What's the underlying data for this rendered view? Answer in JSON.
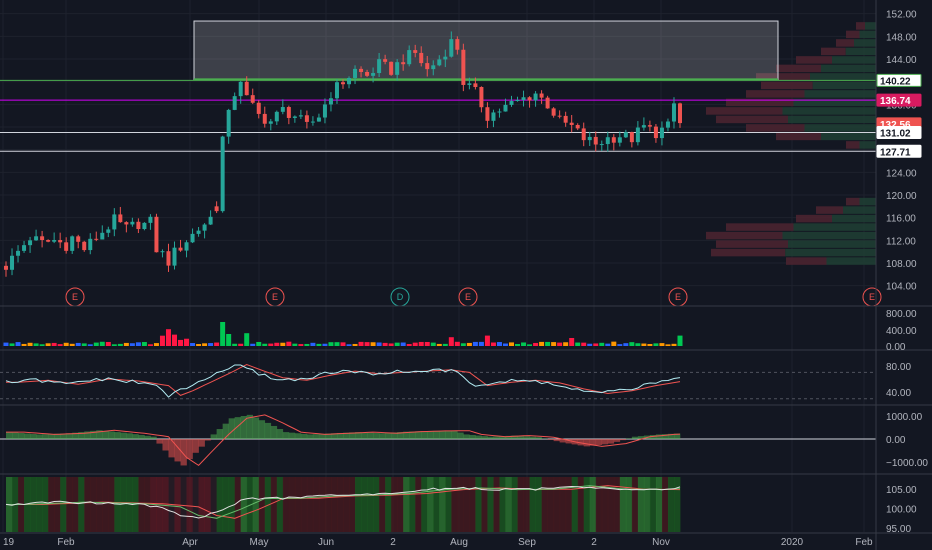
{
  "colors": {
    "background": "#131722",
    "grid": "#1e222d",
    "separator": "#363a45",
    "up": "#26a69a",
    "down": "#ef5350",
    "bright_green": "#4caf50",
    "magenta": "#d500f9",
    "green_line": "#4caf50",
    "white_line": "#d1d4dc",
    "rsi": "#b2ebf2",
    "ma": "#ef5350",
    "vol_red": "#ff1744",
    "vol_orange": "#ff9800",
    "vol_blue": "#2962ff",
    "vol_green": "#00c853"
  },
  "x_axis": {
    "labels": [
      "19",
      "Feb",
      "Apr",
      "May",
      "Jun",
      "2",
      "Aug",
      "Sep",
      "2",
      "Nov",
      "2020",
      "Feb"
    ]
  },
  "price_panel": {
    "y_ticks": [
      "152.00",
      "148.00",
      "144.00",
      "140.00",
      "136.00",
      "132.00",
      "128.00",
      "124.00",
      "120.00",
      "116.00",
      "112.00",
      "108.00",
      "104.00"
    ],
    "tags": [
      {
        "text": "140.22",
        "bg": "#ffffff",
        "fg": "#131722",
        "border": "#4caf50",
        "value": 140.22
      },
      {
        "text": "136.74",
        "bg": "#d81b60",
        "fg": "#ffffff",
        "border": "#d81b60",
        "value": 136.74
      },
      {
        "text": "132.56",
        "bg": "#ef5350",
        "fg": "#ffffff",
        "border": "#ef5350",
        "value": 132.56
      },
      {
        "text": "131.02",
        "bg": "#ffffff",
        "fg": "#131722",
        "border": "#ffffff",
        "value": 131.02
      },
      {
        "text": "127.71",
        "bg": "#ffffff",
        "fg": "#131722",
        "border": "#ffffff",
        "value": 127.71
      }
    ],
    "events": [
      "E",
      "E",
      "D",
      "E",
      "E",
      "E"
    ]
  },
  "volume_panel": {
    "y_ticks": [
      "800.00",
      "400.00",
      "0.00"
    ]
  },
  "rsi_panel": {
    "y_ticks": [
      "80.00",
      "40.00"
    ]
  },
  "macd_panel": {
    "y_ticks": [
      "1000.00",
      "0.00",
      "−1000.00"
    ]
  },
  "bottom_panel": {
    "y_ticks": [
      "105.00",
      "100.00",
      "95.00"
    ]
  },
  "chart_data": {
    "type": "candlestick",
    "price_ylim": [
      102,
      153
    ],
    "horizontal_levels": [
      140.22,
      136.74,
      131.02,
      127.71
    ],
    "resistance_zone": [
      140.3,
      150.7
    ],
    "price_path": [
      [
        0,
        107.5
      ],
      [
        2,
        110
      ],
      [
        4,
        112.5
      ],
      [
        6,
        111.5
      ],
      [
        8,
        112
      ],
      [
        10,
        111.2
      ],
      [
        11,
        112.5
      ],
      [
        13,
        110.5
      ],
      [
        14,
        111.5
      ],
      [
        16,
        113.5
      ],
      [
        18,
        115.5
      ],
      [
        20,
        114
      ],
      [
        22,
        115
      ],
      [
        23,
        114.8
      ],
      [
        24,
        115.2
      ],
      [
        25,
        110.5
      ],
      [
        26,
        109.5
      ],
      [
        27,
        108.3
      ],
      [
        28,
        109.8
      ],
      [
        30,
        112
      ],
      [
        32,
        114
      ],
      [
        34,
        116
      ],
      [
        35,
        118
      ],
      [
        36,
        130
      ],
      [
        37,
        134
      ],
      [
        38,
        138
      ],
      [
        39,
        140.5
      ],
      [
        40,
        137
      ],
      [
        42,
        134
      ],
      [
        44,
        133
      ],
      [
        46,
        135
      ],
      [
        48,
        134
      ],
      [
        50,
        132
      ],
      [
        52,
        134
      ],
      [
        54,
        138
      ],
      [
        56,
        140
      ],
      [
        58,
        142
      ],
      [
        60,
        141
      ],
      [
        62,
        143
      ],
      [
        64,
        142
      ],
      [
        66,
        144
      ],
      [
        68,
        145
      ],
      [
        70,
        142
      ],
      [
        72,
        144
      ],
      [
        74,
        147
      ],
      [
        75,
        146
      ],
      [
        76,
        140
      ],
      [
        78,
        138
      ],
      [
        80,
        134
      ],
      [
        82,
        135
      ],
      [
        84,
        136
      ],
      [
        86,
        137
      ],
      [
        88,
        138
      ],
      [
        90,
        136
      ],
      [
        92,
        133
      ],
      [
        94,
        132
      ],
      [
        96,
        130
      ],
      [
        98,
        129
      ],
      [
        100,
        130
      ],
      [
        102,
        130.5
      ],
      [
        104,
        130
      ],
      [
        106,
        132
      ],
      [
        108,
        131
      ],
      [
        110,
        132
      ],
      [
        111,
        136
      ],
      [
        112,
        132.6
      ]
    ],
    "rsi_path": [
      [
        0,
        55
      ],
      [
        5,
        58
      ],
      [
        10,
        52
      ],
      [
        15,
        60
      ],
      [
        20,
        57
      ],
      [
        25,
        50
      ],
      [
        27,
        35
      ],
      [
        29,
        42
      ],
      [
        32,
        55
      ],
      [
        35,
        68
      ],
      [
        38,
        82
      ],
      [
        40,
        75
      ],
      [
        44,
        62
      ],
      [
        48,
        58
      ],
      [
        52,
        66
      ],
      [
        56,
        72
      ],
      [
        60,
        68
      ],
      [
        64,
        70
      ],
      [
        68,
        72
      ],
      [
        72,
        74
      ],
      [
        75,
        70
      ],
      [
        78,
        50
      ],
      [
        82,
        55
      ],
      [
        86,
        58
      ],
      [
        90,
        54
      ],
      [
        94,
        45
      ],
      [
        98,
        38
      ],
      [
        102,
        42
      ],
      [
        106,
        50
      ],
      [
        110,
        56
      ],
      [
        112,
        65
      ]
    ],
    "macd_path": [
      [
        0,
        300
      ],
      [
        5,
        200
      ],
      [
        10,
        250
      ],
      [
        15,
        380
      ],
      [
        20,
        250
      ],
      [
        24,
        100
      ],
      [
        27,
        -800
      ],
      [
        29,
        -1150
      ],
      [
        31,
        -600
      ],
      [
        34,
        200
      ],
      [
        37,
        900
      ],
      [
        40,
        1050
      ],
      [
        43,
        700
      ],
      [
        46,
        300
      ],
      [
        50,
        200
      ],
      [
        54,
        250
      ],
      [
        58,
        300
      ],
      [
        62,
        250
      ],
      [
        66,
        320
      ],
      [
        70,
        350
      ],
      [
        74,
        360
      ],
      [
        76,
        200
      ],
      [
        80,
        100
      ],
      [
        84,
        150
      ],
      [
        88,
        80
      ],
      [
        92,
        -150
      ],
      [
        96,
        -320
      ],
      [
        100,
        -200
      ],
      [
        104,
        100
      ],
      [
        108,
        200
      ],
      [
        112,
        250
      ]
    ],
    "bottom_path": [
      [
        0,
        101
      ],
      [
        10,
        101.6
      ],
      [
        20,
        101.2
      ],
      [
        26,
        100.4
      ],
      [
        29,
        98.2
      ],
      [
        32,
        97.5
      ],
      [
        36,
        99.8
      ],
      [
        40,
        102.5
      ],
      [
        46,
        102.6
      ],
      [
        52,
        103.2
      ],
      [
        58,
        103.4
      ],
      [
        64,
        103.8
      ],
      [
        70,
        104.8
      ],
      [
        76,
        105.2
      ],
      [
        82,
        104.8
      ],
      [
        88,
        104.9
      ],
      [
        94,
        105.8
      ],
      [
        100,
        104.9
      ],
      [
        106,
        104.8
      ],
      [
        112,
        105.3
      ]
    ]
  }
}
